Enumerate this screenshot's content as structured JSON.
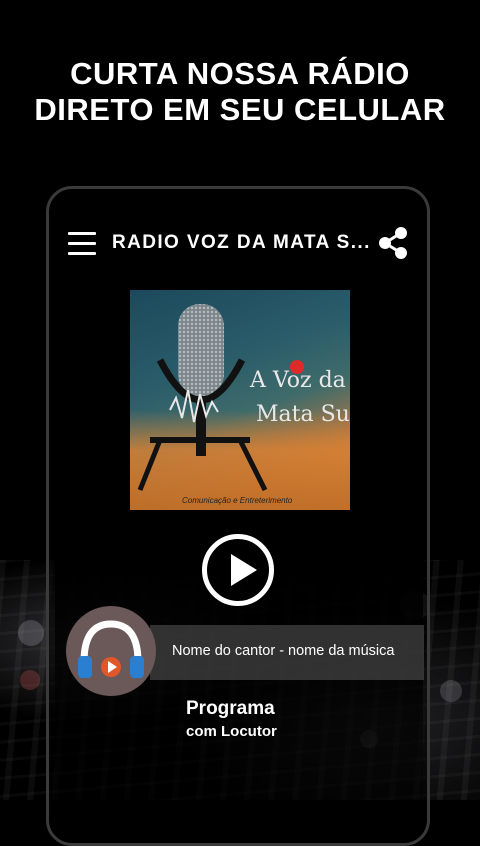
{
  "promo": {
    "line1": "CURTA NOSSA RÁDIO",
    "line2": "DIRETO EM SEU CELULAR"
  },
  "app": {
    "title": "RADIO VOZ DA MATA S...",
    "menu_icon": "hamburger-menu-icon",
    "share_icon": "share-icon"
  },
  "cover": {
    "line1": "A Voz da",
    "line2": "Mata Sul",
    "subtitle": "Comunicação e Entreterimento"
  },
  "player": {
    "play_icon": "play-icon",
    "now_playing": "Nome do cantor - nome da música",
    "program": "Programa",
    "host": "com Locutor"
  },
  "colors": {
    "background": "#000000",
    "text": "#ffffff",
    "logo_bg": "#6b5858",
    "logo_accent": "#e0572a",
    "logo_blue": "#2a7fd0"
  }
}
